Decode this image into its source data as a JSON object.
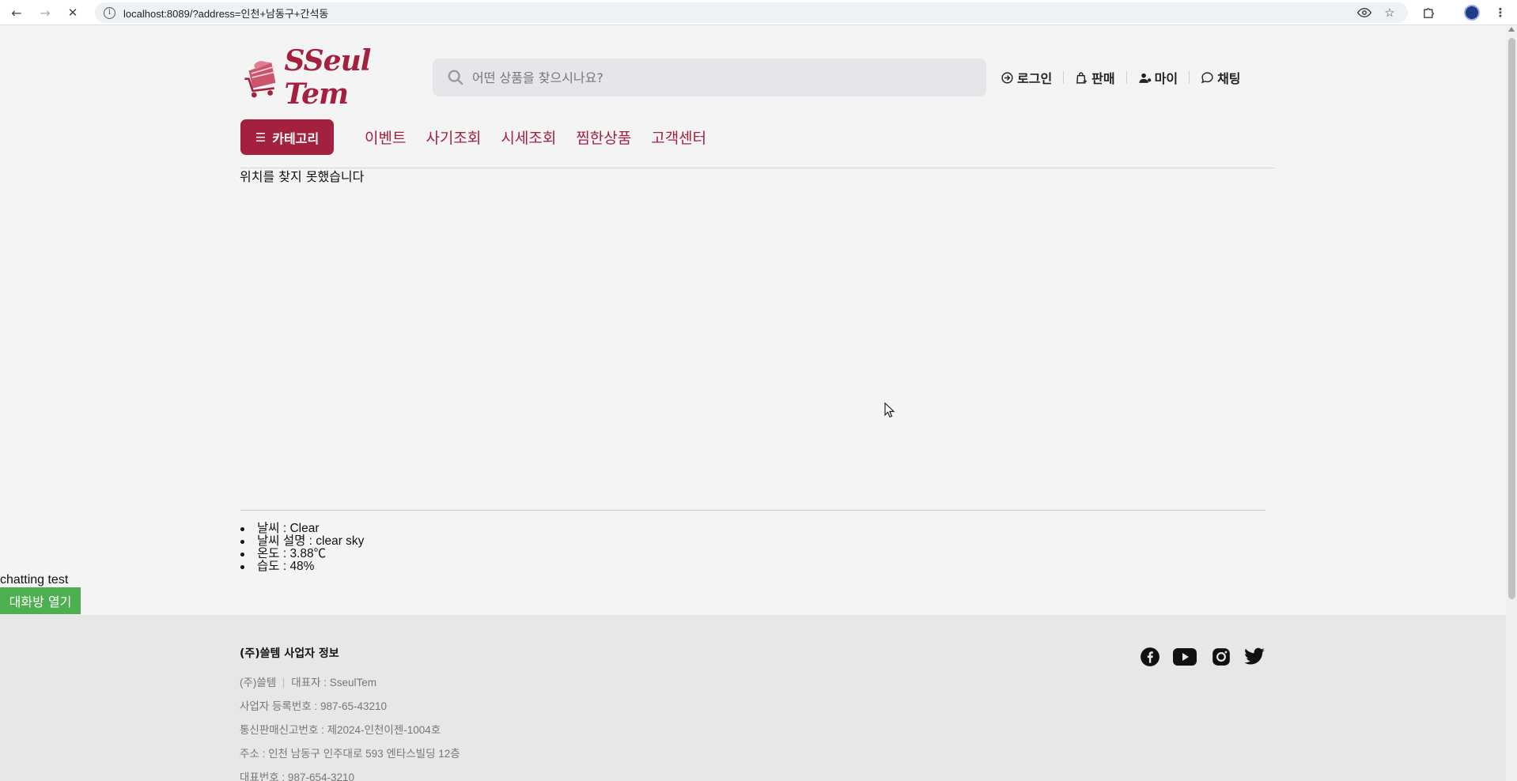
{
  "browser": {
    "url": "localhost:8089/?address=인천+남동구+간석동"
  },
  "header": {
    "logo_text": "SSeul Tem",
    "search_placeholder": "어떤 상품을 찾으시나요?",
    "links": {
      "login": "로그인",
      "sell": "판매",
      "my": "마이",
      "chat": "채팅"
    }
  },
  "nav": {
    "category_label": "카테고리",
    "links": [
      "이벤트",
      "사기조회",
      "시세조회",
      "찜한상품",
      "고객센터"
    ]
  },
  "main": {
    "location_message": "위치를 찾지 못했습니다"
  },
  "weather": {
    "items": [
      "날씨 : Clear",
      "날씨 설명 : clear sky",
      "온도 : 3.88℃",
      "습도 : 48%"
    ]
  },
  "chat_widget": {
    "label": "chatting test",
    "button": "대화방 열기"
  },
  "footer": {
    "title": "(주)쓸템 사업자 정보",
    "company": "(주)쓸템",
    "ceo": "대표자 : SseulTem",
    "business_number": "사업자 등록번호 : 987-65-43210",
    "mail_order_number": "통신판매신고번호 : 제2024-인천이젠-1004호",
    "address": "주소 : 인천 남동구 인주대로 593 엔타스빌딩 12층",
    "phone": "대표번호 : 987-654-3210"
  },
  "colors": {
    "brand": "#a3213f",
    "chat_button": "#4caf50",
    "footer_bg": "#e6e7e9"
  }
}
